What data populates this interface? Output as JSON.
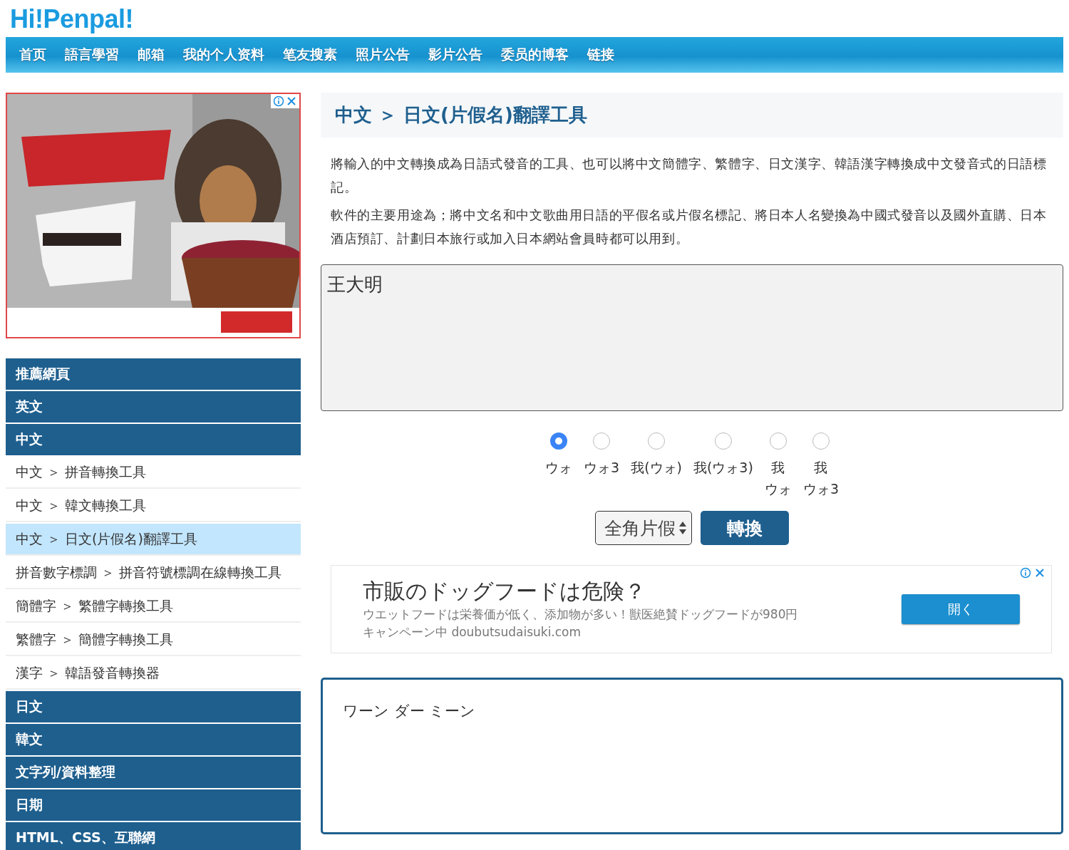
{
  "logo": "Hi!Penpal!",
  "nav": [
    "首页",
    "語言學習",
    "邮箱",
    "我的个人资料",
    "笔友搜素",
    "照片公告",
    "影片公告",
    "委员的博客",
    "链接"
  ],
  "sidebar": [
    {
      "label": "推薦網頁",
      "kind": "header"
    },
    {
      "label": "英文",
      "kind": "header"
    },
    {
      "label": "中文",
      "kind": "header"
    },
    {
      "label": "中文 ＞ 拼音轉換工具",
      "kind": "link",
      "selected": false
    },
    {
      "label": "中文 ＞ 韓文轉換工具",
      "kind": "link",
      "selected": false
    },
    {
      "label": "中文 ＞ 日文(片假名)翻譯工具",
      "kind": "link",
      "selected": true
    },
    {
      "label": "拼音數字標調 ＞ 拼音符號標調在線轉換工具",
      "kind": "link",
      "selected": false
    },
    {
      "label": "簡體字 ＞ 繁體字轉換工具",
      "kind": "link",
      "selected": false
    },
    {
      "label": "繁體字 ＞ 簡體字轉換工具",
      "kind": "link",
      "selected": false
    },
    {
      "label": "漢字 ＞ 韓語發音轉換器",
      "kind": "link",
      "selected": false
    },
    {
      "label": "日文",
      "kind": "header"
    },
    {
      "label": "韓文",
      "kind": "header"
    },
    {
      "label": "文字列/資料整理",
      "kind": "header"
    },
    {
      "label": "日期",
      "kind": "header"
    },
    {
      "label": "HTML、CSS、互聯網",
      "kind": "header"
    }
  ],
  "title": "中文 ＞ 日文(片假名)翻譯工具",
  "description": [
    "將輸入的中文轉換成為日語式發音的工具、也可以將中文簡體字、繁體字、日文漢字、韓語漢字轉換成中文發音式的日語標記。",
    "軟件的主要用途為；將中文名和中文歌曲用日語的平假名或片假名標記、將日本人名變換為中國式發音以及國外直購、日本酒店預訂、計劃日本旅行或加入日本網站會員時都可以用到。"
  ],
  "input": {
    "value": "王大明"
  },
  "options": [
    {
      "lines": [
        "ウォ"
      ],
      "selected": true
    },
    {
      "lines": [
        "ウォ3"
      ],
      "selected": false
    },
    {
      "lines": [
        "我(ウォ)"
      ],
      "selected": false
    },
    {
      "lines": [
        "我(ウォ3)"
      ],
      "selected": false
    },
    {
      "lines": [
        "我",
        "ウォ"
      ],
      "selected": false
    },
    {
      "lines": [
        "我",
        "ウォ3"
      ],
      "selected": false
    }
  ],
  "script_select": {
    "value": "全角片假"
  },
  "convert_button": "轉換",
  "banner_ad": {
    "headline": "市販のドッグフードは危険？",
    "body": "ウエットフードは栄養価が低く、添加物が多い！獣医絶賛ドッグフードが980円",
    "footer": "キャンペーン中 doubutsudaisuki.com",
    "button": "開く"
  },
  "output": {
    "value": "ワーン ダー ミーン"
  }
}
